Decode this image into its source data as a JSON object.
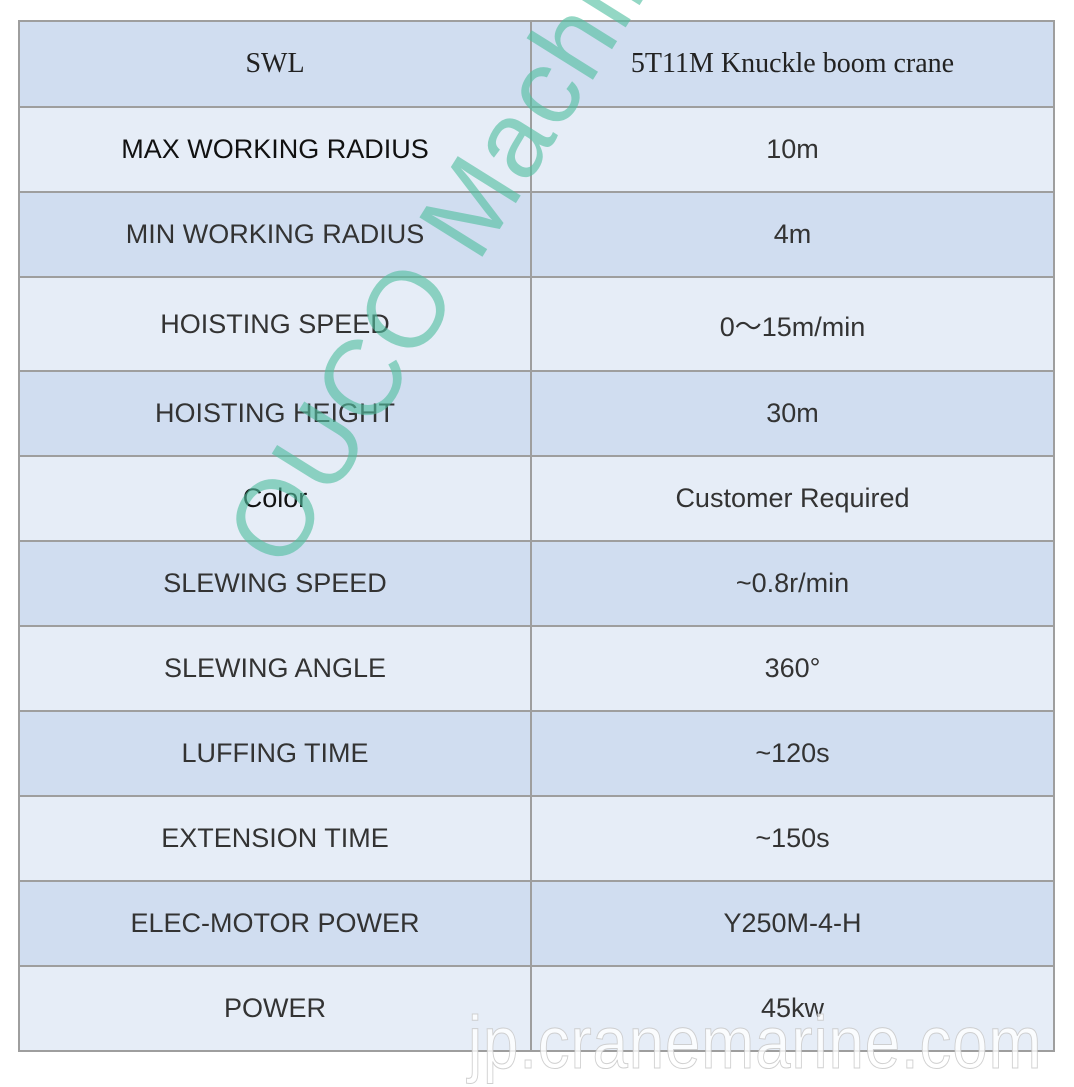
{
  "table": {
    "header": {
      "label": "SWL",
      "value": "5T11M Knuckle boom crane"
    },
    "rows": [
      {
        "label": "MAX WORKING RADIUS",
        "value": "10m"
      },
      {
        "label": "MIN WORKING RADIUS",
        "value": "4m"
      },
      {
        "label": "HOISTING SPEED",
        "value": "0～15m/min"
      },
      {
        "label": "HOISTING HEIGHT",
        "value": "30m"
      },
      {
        "label": "Color",
        "value": "Customer Required"
      },
      {
        "label": "SLEWING SPEED",
        "value": "~0.8r/min"
      },
      {
        "label": "SLEWING ANGLE",
        "value": "360°"
      },
      {
        "label": "LUFFING TIME",
        "value": "~120s"
      },
      {
        "label": "EXTENSION TIME",
        "value": "~150s"
      },
      {
        "label": "ELEC-MOTOR POWER",
        "value": "Y250M-4-H"
      },
      {
        "label": "POWER",
        "value": "45kw"
      }
    ]
  },
  "watermarks": {
    "brand": "OUCO Machinery",
    "site": "jp.cranemarine.com"
  },
  "colors": {
    "row_dark": "#d0ddf0",
    "row_light": "#e6edf7",
    "border": "#9e9e9e",
    "watermark": "#50be a0"
  }
}
